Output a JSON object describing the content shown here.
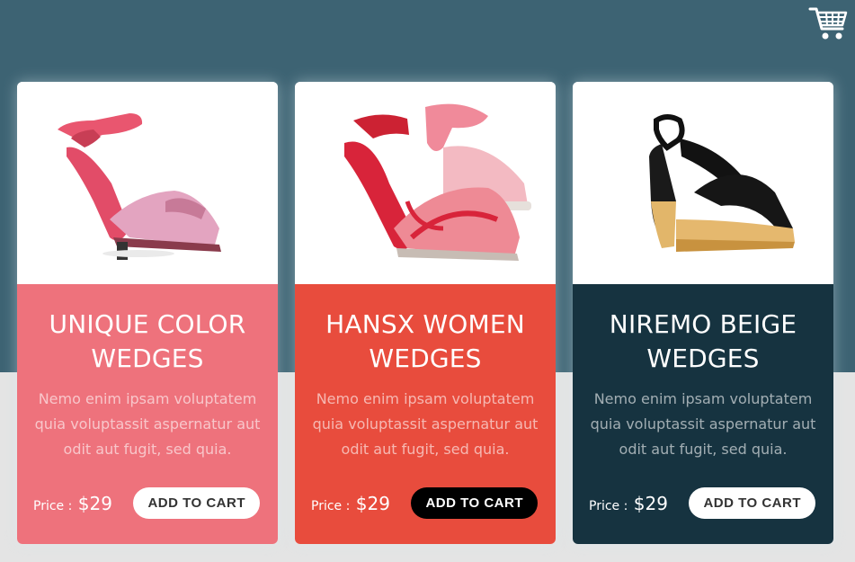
{
  "colors": {
    "hero_bg": "#3d6373",
    "page_bg": "#e4e4e4",
    "card_pink": "#ee727c",
    "card_red": "#e84c3d",
    "card_dark": "#163340"
  },
  "header": {
    "cart_icon": "shopping-cart-icon"
  },
  "products": [
    {
      "title": "UNIQUE COLOR WEDGES",
      "description": "Nemo enim ipsam voluptatem quia voluptassit aspernatur aut odit aut fugit, sed quia.",
      "price_label": "Price :",
      "price": "$29",
      "button_label": "ADD TO CART"
    },
    {
      "title": "HANSX WOMEN WEDGES",
      "description": "Nemo enim ipsam voluptatem quia voluptassit aspernatur aut odit aut fugit, sed quia.",
      "price_label": "Price :",
      "price": "$29",
      "button_label": "ADD TO CART"
    },
    {
      "title": "NIREMO BEIGE WEDGES",
      "description": "Nemo enim ipsam voluptatem quia voluptassit aspernatur aut odit aut fugit, sed quia.",
      "price_label": "Price :",
      "price": "$29",
      "button_label": "ADD TO CART"
    }
  ]
}
